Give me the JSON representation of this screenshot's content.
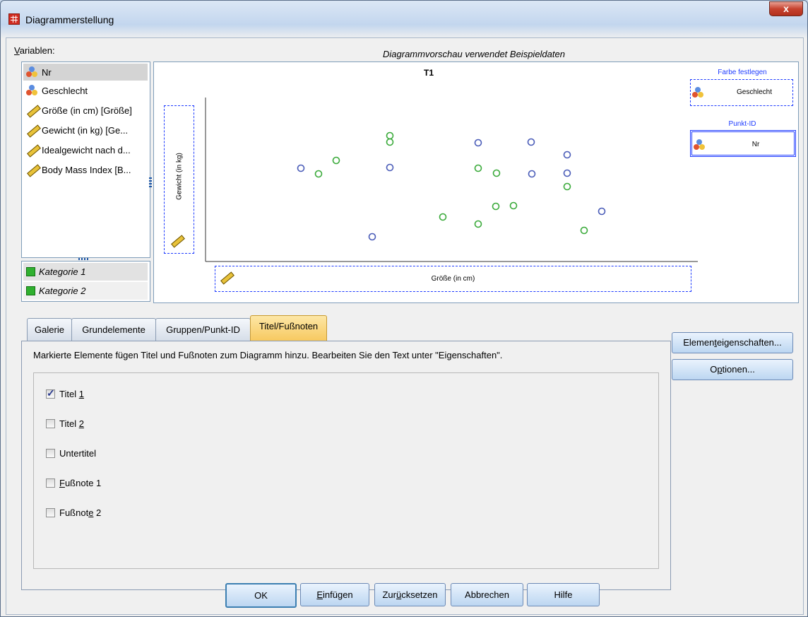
{
  "window": {
    "title": "Diagrammerstellung",
    "close_label": "x"
  },
  "variables": {
    "label": "Variablen:",
    "items": [
      {
        "label": "Nr",
        "icon": "nominal-icon"
      },
      {
        "label": "Geschlecht",
        "icon": "nominal-icon"
      },
      {
        "label": "Größe (in cm) [Größe]",
        "icon": "scale-ruler-icon"
      },
      {
        "label": "Gewicht (in kg) [Ge...",
        "icon": "scale-ruler-icon"
      },
      {
        "label": "Idealgewicht nach d...",
        "icon": "scale-ruler-icon"
      },
      {
        "label": "Body Mass Index [B...",
        "icon": "scale-ruler-icon"
      }
    ]
  },
  "categories": {
    "items": [
      "Kategorie 1",
      "Kategorie 2"
    ]
  },
  "preview": {
    "caption": "Diagrammvorschau verwendet Beispieldaten",
    "chart_title": "T1",
    "y_axis_label": "Gewicht (in kg)",
    "x_axis_label": "Größe (in cm)",
    "color_zone_title": "Farbe festlegen",
    "color_zone_value": "Geschlecht",
    "pointid_zone_title": "Punkt-ID",
    "pointid_zone_value": "Nr"
  },
  "chart_data": {
    "type": "scatter",
    "title": "T1",
    "xlabel": "Größe (in cm)",
    "ylabel": "Gewicht (in kg)",
    "series": [
      {
        "color": "#4a5cb8",
        "points": [
          [
            135,
            101
          ],
          [
            261,
            100
          ],
          [
            386,
            65
          ],
          [
            461,
            64
          ],
          [
            512,
            82
          ],
          [
            462,
            109
          ],
          [
            512,
            108
          ],
          [
            561,
            162
          ],
          [
            236,
            198
          ]
        ]
      },
      {
        "color": "#3aaa3a",
        "points": [
          [
            160,
            109
          ],
          [
            185,
            90
          ],
          [
            261,
            55
          ],
          [
            261,
            64
          ],
          [
            386,
            101
          ],
          [
            412,
            108
          ],
          [
            411,
            155
          ],
          [
            436,
            154
          ],
          [
            512,
            127
          ],
          [
            336,
            170
          ],
          [
            386,
            180
          ],
          [
            536,
            189
          ]
        ]
      }
    ]
  },
  "tabs": [
    {
      "label": "Galerie"
    },
    {
      "label": "Grundelemente"
    },
    {
      "label": "Gruppen/Punkt-ID"
    },
    {
      "label": "Titel/Fußnoten"
    }
  ],
  "tab_content": {
    "description": "Markierte Elemente fügen Titel und Fußnoten zum Diagramm hinzu. Bearbeiten Sie den Text unter \"Eigenschaften\".",
    "options": [
      {
        "label_pre": "Titel ",
        "label_u": "1",
        "label_post": "",
        "checked": true
      },
      {
        "label_pre": "Titel ",
        "label_u": "2",
        "label_post": "",
        "checked": false
      },
      {
        "label_pre": "Untertitel",
        "label_u": "",
        "label_post": "",
        "checked": false
      },
      {
        "label_pre": "",
        "label_u": "F",
        "label_post": "ußnote 1",
        "checked": false
      },
      {
        "label_pre": "Fußnot",
        "label_u": "e",
        "label_post": " 2",
        "checked": false
      }
    ]
  },
  "side_buttons": {
    "element_props_pre": "Elemen",
    "element_props_u": "t",
    "element_props_post": "eigenschaften...",
    "options_pre": "O",
    "options_u": "p",
    "options_post": "tionen..."
  },
  "buttons": {
    "ok": "OK",
    "insert_u": "E",
    "insert_post": "infügen",
    "reset_pre": "Zur",
    "reset_u": "ü",
    "reset_post": "cksetzen",
    "cancel": "Abbrechen",
    "help": "Hilfe"
  }
}
